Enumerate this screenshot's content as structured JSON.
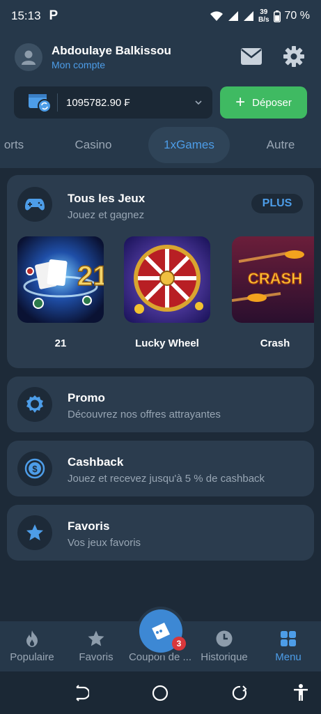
{
  "status_bar": {
    "time": "15:13",
    "app_letter": "P",
    "net_speed_value": "39",
    "net_speed_unit": "B/s",
    "battery": "70 %"
  },
  "header": {
    "user_name": "Abdoulaye Balkissou",
    "account_link": "Mon compte",
    "balance": "1095782.90 ₣",
    "deposit_label": "Déposer"
  },
  "tabs": [
    {
      "label": "orts"
    },
    {
      "label": "Casino"
    },
    {
      "label": "1xGames",
      "active": true
    },
    {
      "label": "Autre"
    }
  ],
  "games_card": {
    "title": "Tous les Jeux",
    "subtitle": "Jouez et gagnez",
    "more_label": "PLUS",
    "games": [
      {
        "name": "21",
        "tile_text": "21"
      },
      {
        "name": "Lucky Wheel"
      },
      {
        "name": "Crash",
        "tile_text": "CRASH"
      }
    ]
  },
  "promo_card": {
    "title": "Promo",
    "subtitle": "Découvrez nos offres attrayantes"
  },
  "cashback_card": {
    "title": "Cashback",
    "subtitle": "Jouez et recevez jusqu'à 5 % de cashback"
  },
  "favoris_card": {
    "title": "Favoris",
    "subtitle": "Vos jeux favoris"
  },
  "bottom_nav": {
    "popular": "Populaire",
    "favorites": "Favoris",
    "coupon": "Coupon de ...",
    "coupon_count": "3",
    "history": "Historique",
    "menu": "Menu"
  },
  "colors": {
    "accent": "#4d9de8",
    "deposit_green": "#3fba62",
    "background": "#1d2a38",
    "card": "#2b3c4e"
  }
}
